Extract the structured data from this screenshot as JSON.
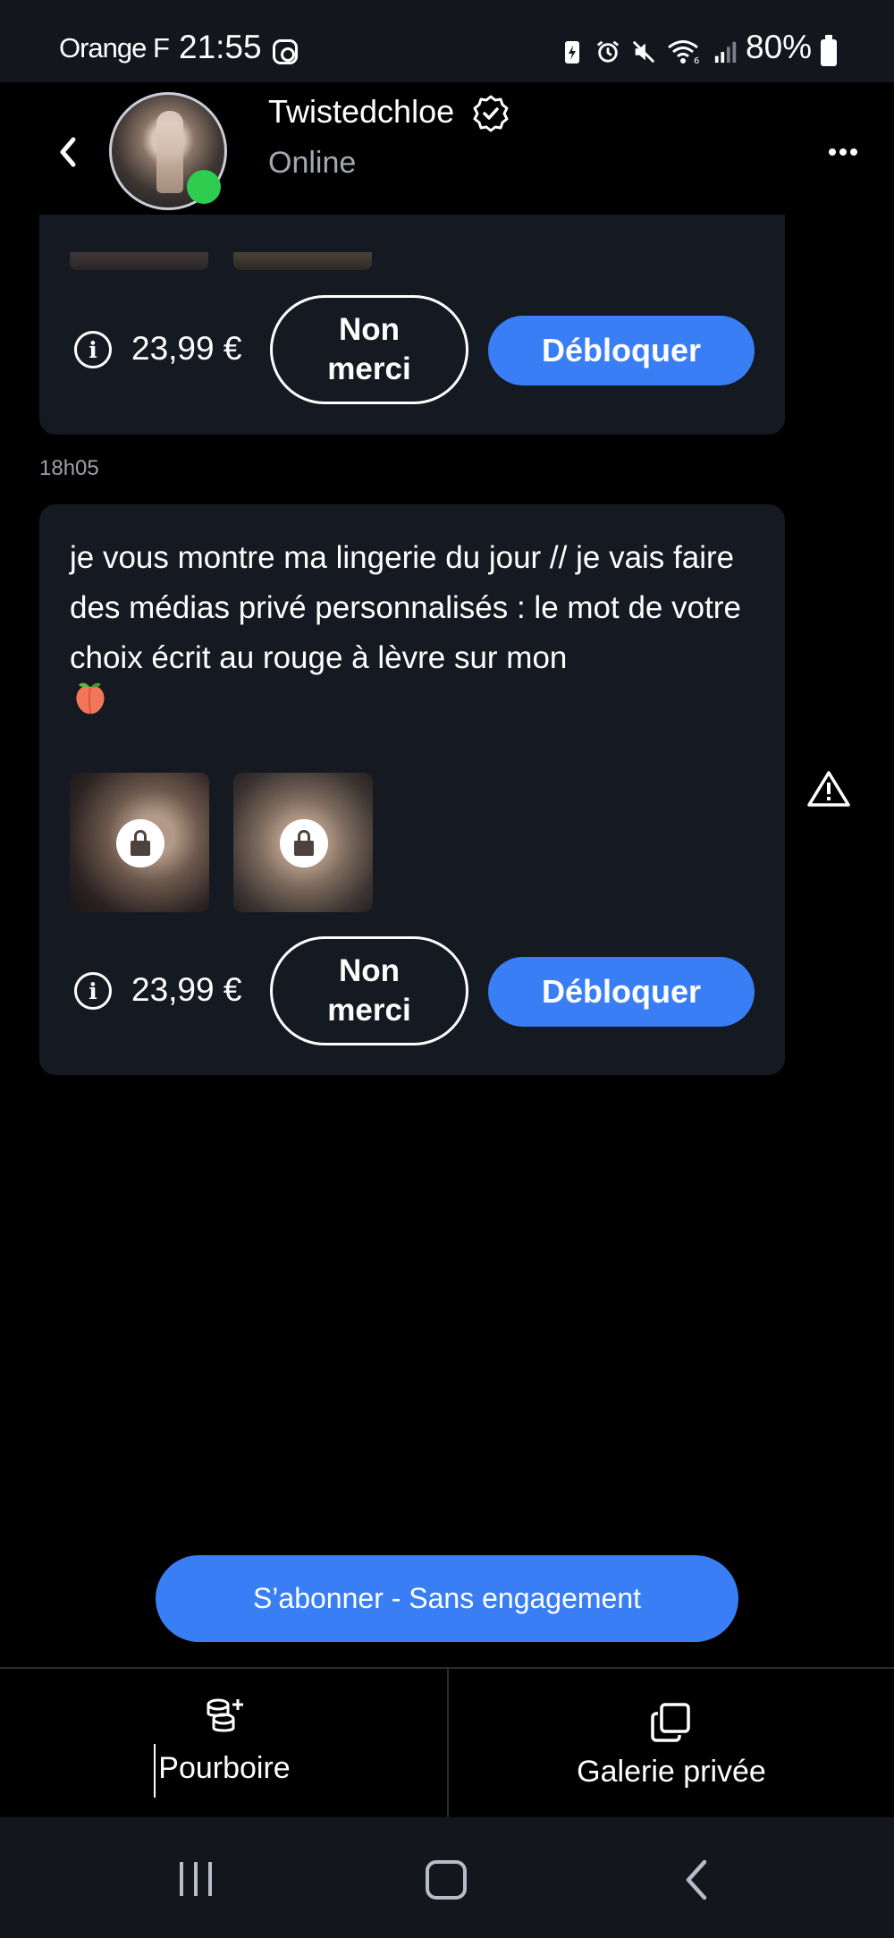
{
  "status_bar": {
    "carrier": "Orange F",
    "time": "21:55",
    "battery": "80%",
    "icons": [
      "instagram-icon",
      "battery-saver-icon",
      "alarm-icon",
      "mute-icon",
      "wifi-icon",
      "signal-icon"
    ]
  },
  "header": {
    "name": "Twistedchloe",
    "status": "Online",
    "icons": [
      "back-chevron-icon",
      "verified-badge-icon",
      "more-options-icon"
    ]
  },
  "messages": [
    {
      "price": "23,99 €",
      "decline_label": "Non merci",
      "unlock_label": "Débloquer"
    },
    {
      "time": "18h05",
      "text": "je vous montre ma lingerie du jour // je vais faire des médias privé personnalisés : le mot de votre choix écrit au rouge à lèvre sur mon",
      "emoji": "peach-emoji",
      "price": "23,99 €",
      "decline_label": "Non merci",
      "unlock_label": "Débloquer"
    }
  ],
  "subscribe_label": "S’abonner - Sans engagement",
  "actions": {
    "tip_label": "Pourboire",
    "gallery_label": "Galerie privée"
  },
  "colors": {
    "accent": "#3a7ef5",
    "bubble": "#151922",
    "online": "#2ecc4f"
  }
}
